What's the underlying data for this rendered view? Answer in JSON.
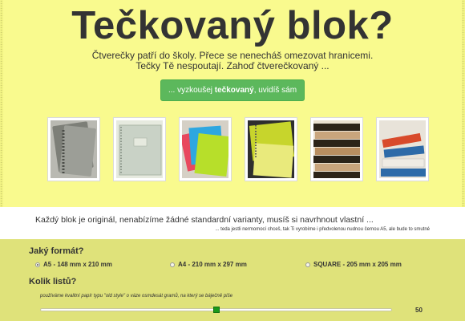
{
  "hero": {
    "title": "Tečkovaný blok?",
    "subtitle_line1": "Čtverečky patří do školy. Přece se nenecháš omezovat hranicemi.",
    "subtitle_line2": "Tečky Tě nespoutají. Zahoď čtverečkovaný ...",
    "cta_prefix": "... vyzkoušej ",
    "cta_bold": "tečkovaný",
    "cta_suffix": ", uvidíš sám",
    "cta_color": "#5cb85c"
  },
  "gallery": {
    "photos": [
      {
        "name": "notebooks-spiral-gray",
        "colors": [
          "#b9b9b2",
          "#7d7f78",
          "#4b4d48"
        ]
      },
      {
        "name": "notebook-mint-cover",
        "colors": [
          "#c9d2c6",
          "#a9b5a6",
          "#e6eadf"
        ]
      },
      {
        "name": "notebooks-colorful",
        "colors": [
          "#b7df2a",
          "#e8485e",
          "#2ea7e0"
        ]
      },
      {
        "name": "notebook-lime-stack",
        "colors": [
          "#c7d52c",
          "#2e2e2e",
          "#e9ea7c"
        ]
      },
      {
        "name": "notebooks-brown-stack",
        "colors": [
          "#2c2419",
          "#c9a57c",
          "#eae1d0"
        ]
      },
      {
        "name": "notebooks-red-blue",
        "colors": [
          "#d84a2a",
          "#2d6aa8",
          "#e8e3d9"
        ]
      }
    ]
  },
  "info": {
    "main_text": "Každý blok je originál, nenabízíme žádné standardní varianty, musíš si navrhnout vlastní ...",
    "note_text": "... teda jestli nermomocí chceš, tak Ti vyrobíme i předvolenou nudnou černou A5, ale bude to smutné"
  },
  "form": {
    "format_label": "Jaký formát?",
    "format_options": [
      {
        "label": "A5 - 148 mm x 210 mm",
        "selected": true
      },
      {
        "label": "A4 - 210 mm x 297 mm",
        "selected": false
      },
      {
        "label": "SQUARE - 205 mm x 205 mm",
        "selected": false
      }
    ],
    "sheets_label": "Kolik listů?",
    "paper_note": "používáme kvalitní papír typu \"old style\" o váze osmdesát gramů, na který se báječně píše",
    "sheets_value": "50",
    "slider_fraction": 0.5
  },
  "colors": {
    "background": "#f3f584",
    "form_background": "#dfe27a",
    "slider_thumb": "#1a9a1a"
  }
}
